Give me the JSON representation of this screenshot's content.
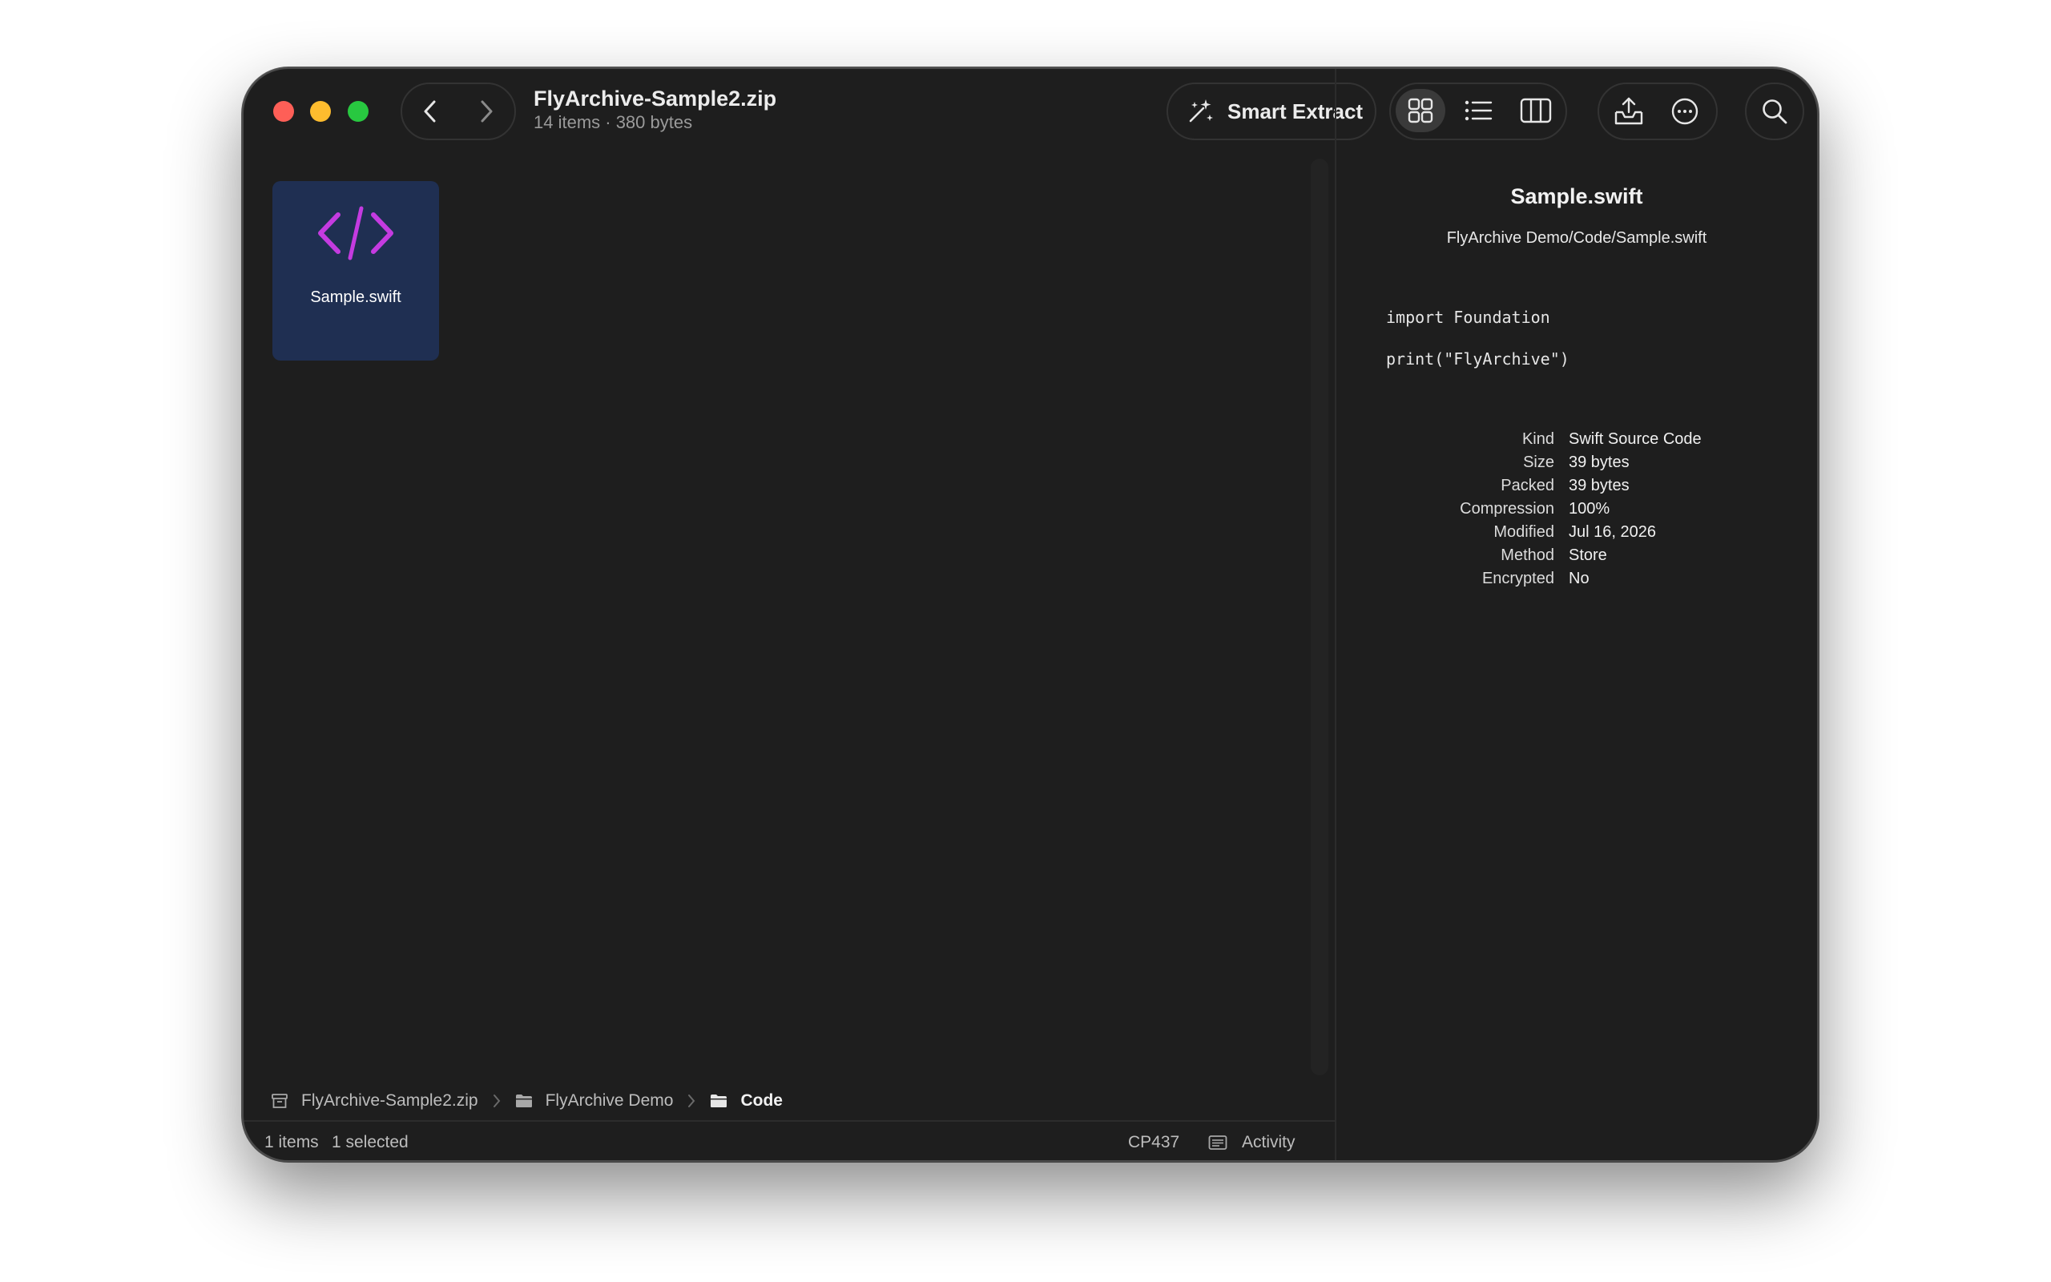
{
  "window": {
    "title": "FlyArchive-Sample2.zip",
    "subtitle": "14 items · 380 bytes"
  },
  "toolbar": {
    "smart_extract_label": "Smart Extract",
    "view_modes": [
      "grid",
      "list",
      "columns"
    ],
    "selected_view": "grid"
  },
  "files": [
    {
      "name": "Sample.swift",
      "icon": "code-icon",
      "selected": true
    }
  ],
  "breadcrumb": [
    {
      "label": "FlyArchive-Sample2.zip",
      "icon": "archive-icon"
    },
    {
      "label": "FlyArchive Demo",
      "icon": "folder-icon"
    },
    {
      "label": "Code",
      "icon": "folder-icon"
    }
  ],
  "status": {
    "items": "1 items",
    "selected": "1 selected",
    "encoding": "CP437",
    "activity": "Activity"
  },
  "inspector": {
    "title": "Sample.swift",
    "path": "FlyArchive Demo/Code/Sample.swift",
    "code_lines": [
      "import Foundation",
      "print(\"FlyArchive\")"
    ],
    "properties": [
      {
        "key": "Kind",
        "value": "Swift Source Code"
      },
      {
        "key": "Size",
        "value": "39 bytes"
      },
      {
        "key": "Packed",
        "value": "39 bytes"
      },
      {
        "key": "Compression",
        "value": "100%"
      },
      {
        "key": "Modified",
        "value": "Jul 16, 2026"
      },
      {
        "key": "Method",
        "value": "Store"
      },
      {
        "key": "Encrypted",
        "value": "No"
      }
    ]
  },
  "colors": {
    "window_bg": "#1e1e1e",
    "selection_bg": "#1f2f52",
    "code_icon": "#c43be0",
    "close": "#fe5f57",
    "minimize": "#febc2e",
    "zoom": "#28c840"
  }
}
